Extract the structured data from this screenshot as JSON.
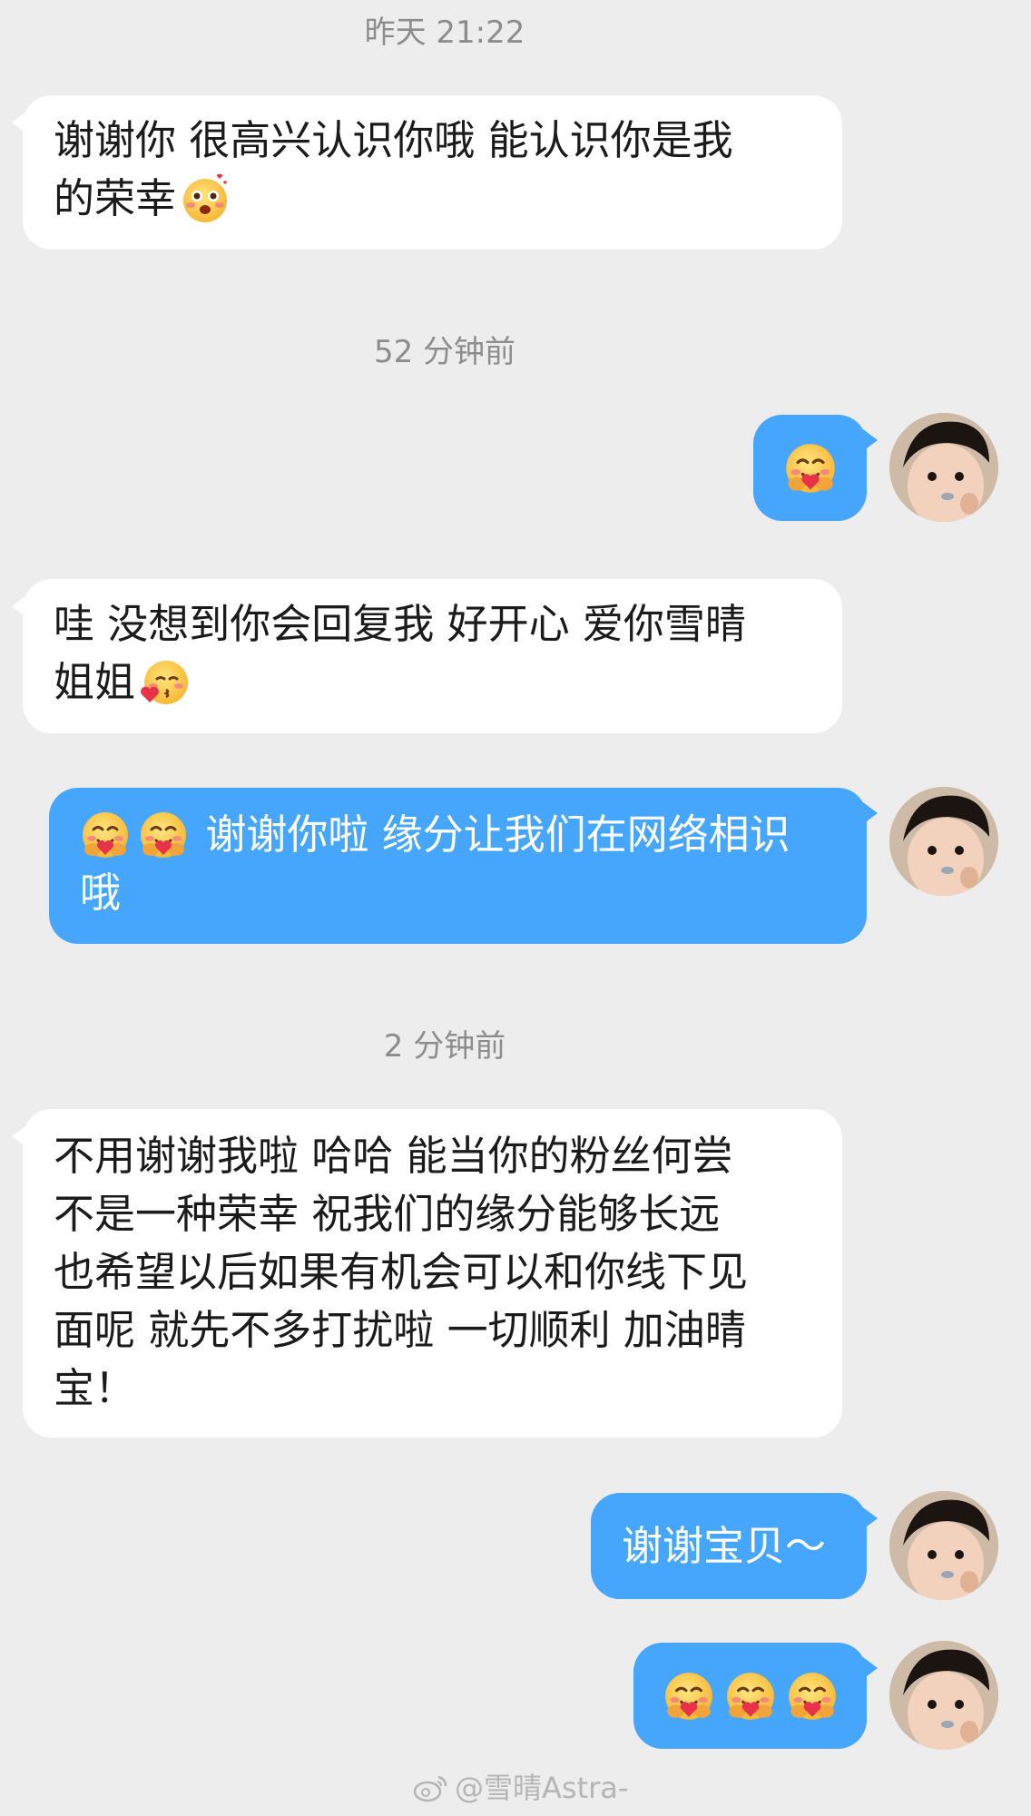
{
  "timestamps": {
    "t1": "昨天 21:22",
    "t2": "52 分钟前",
    "t3": "2 分钟前"
  },
  "messages": {
    "m1": {
      "line1": "谢谢你 很高兴认识你哦 能认识你是我",
      "line2": "的荣幸",
      "emoji": "blushing-love-emoji"
    },
    "m2": {
      "emoji": "hug-emoji"
    },
    "m3": {
      "line1": "哇 没想到你会回复我 好开心 爱你雪晴",
      "line2": "姐姐",
      "emoji": "heart-kiss-emoji"
    },
    "m4": {
      "line1": "谢谢你啦 缘分让我们在网络相识",
      "line2": "哦",
      "emoji": "hug-emoji"
    },
    "m5": {
      "lines": [
        "不用谢谢我啦 哈哈 能当你的粉丝何尝",
        "不是一种荣幸 祝我们的缘分能够长远",
        "也希望以后如果有机会可以和你线下见",
        "面呢 就先不多打扰啦 一切顺利 加油晴",
        "宝！"
      ]
    },
    "m6": {
      "text": "谢谢宝贝～"
    },
    "m7": {
      "emoji": "hug-emoji"
    }
  },
  "watermark": {
    "text": "@雪晴Astra-"
  },
  "colors": {
    "bg": "#ededed",
    "incoming": "#ffffff",
    "outgoing": "#46a6fb",
    "timestamp": "#8d8d8d"
  }
}
